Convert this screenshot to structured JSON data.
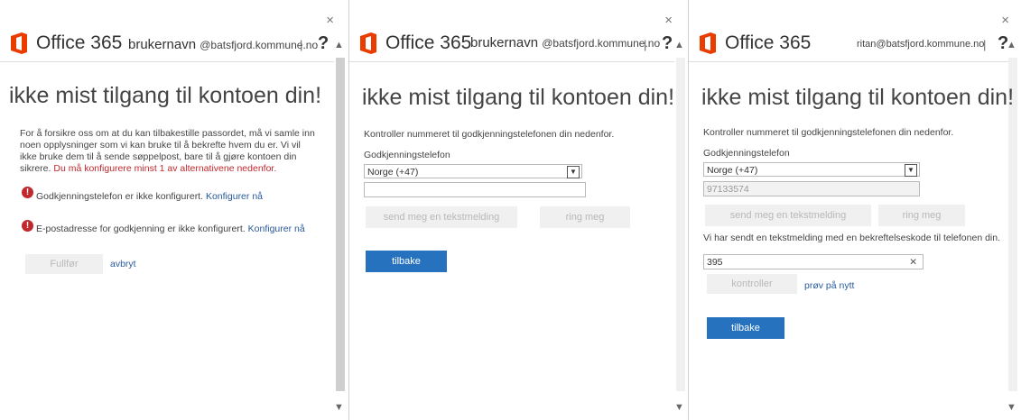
{
  "brand": "Office 365",
  "close_glyph": "×",
  "help_glyph": "?",
  "separator": "|",
  "icons": {
    "close": "close-icon",
    "help": "help-icon",
    "error": "error-icon",
    "chevron": "chevron-down-icon",
    "clear": "clear-icon"
  },
  "colors": {
    "brand_orange": "#eb3c00",
    "primary_button": "#2672bf",
    "warning_text": "#c0282d",
    "link": "#2a5a9b"
  },
  "panel1": {
    "username": "brukernavn",
    "domain": "@batsfjord.kommune.no",
    "title": "ikke mist tilgang til kontoen din!",
    "intro": "For å forsikre oss om at du kan tilbakestille passordet, må vi samle inn noen opplysninger som vi kan bruke til å bekrefte hvem du er. Vi vil ikke bruke dem til å sende søppelpost, bare til å gjøre kontoen din sikrere.",
    "intro_warning": "Du må konfigurere minst 1 av alternativene nedenfor.",
    "item1_text": "Godkjenningstelefon er ikke konfigurert.",
    "item1_link": "Konfigurer nå",
    "item2_text": "E-postadresse for godkjenning er ikke konfigurert.",
    "item2_link": "Konfigurer nå",
    "finish_label": "Fullfør",
    "cancel_label": "avbryt"
  },
  "panel2": {
    "username": "brukernavn",
    "domain": "@batsfjord.kommune.no",
    "title": "ikke mist tilgang til kontoen din!",
    "instruction": "Kontroller nummeret til godkjenningstelefonen din nedenfor.",
    "phone_label": "Godkjenningstelefon",
    "country_value": "Norge (+47)",
    "phone_value": "",
    "sms_label": "send meg en tekstmelding",
    "call_label": "ring meg",
    "back_label": "tilbake"
  },
  "panel3": {
    "account": "ritan@batsfjord.kommune.no",
    "title": "ikke mist tilgang til kontoen din!",
    "instruction": "Kontroller nummeret til godkjenningstelefonen din nedenfor.",
    "phone_label": "Godkjenningstelefon",
    "country_value": "Norge (+47)",
    "phone_value": "97133574",
    "sms_label": "send meg en tekstmelding",
    "call_label": "ring meg",
    "sent_message": "Vi har sendt en tekstmelding med en bekreftelseskode til telefonen din.",
    "code_value": "395",
    "verify_label": "kontroller",
    "retry_label": "prøv på nytt",
    "back_label": "tilbake"
  }
}
